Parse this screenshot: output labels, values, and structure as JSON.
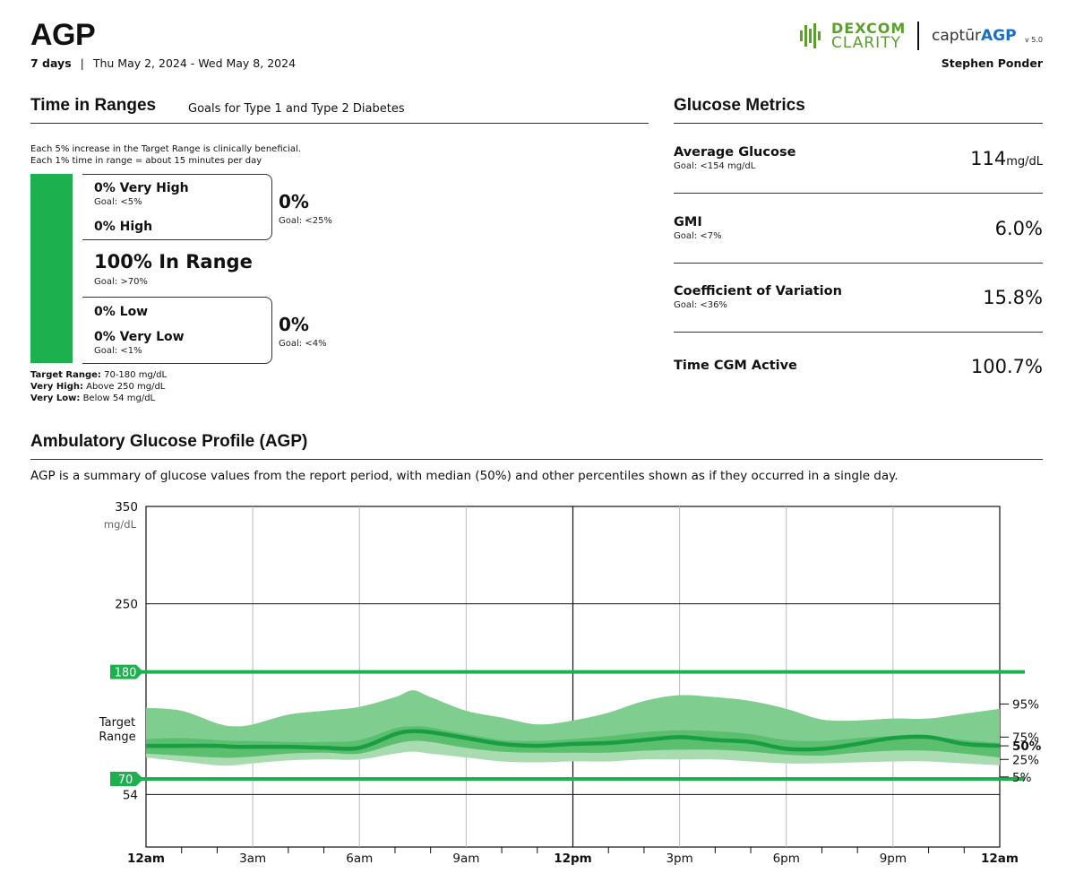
{
  "header": {
    "title": "AGP",
    "days": "7 days",
    "separator": "|",
    "date_range": "Thu May 2, 2024 - Wed May 8, 2024",
    "logo_dexcom": "DEXCOM",
    "logo_clarity": "CLARITY",
    "logo_captur": "captūr",
    "logo_agp": "AGP",
    "logo_version": "v 5.0",
    "patient_name": "Stephen Ponder"
  },
  "time_in_ranges": {
    "title": "Time in Ranges",
    "subtitle": "Goals for Type 1 and Type 2 Diabetes",
    "note1": "Each 5% increase in the Target Range is clinically beneficial.",
    "note2": "Each 1% time in range = about 15 minutes per day",
    "very_high": "0% Very High",
    "very_high_goal": "Goal: <5%",
    "high": "0% High",
    "high_combined": "0%",
    "high_combined_goal": "Goal: <25%",
    "in_range": "100% In Range",
    "in_range_goal": "Goal: >70%",
    "low": "0% Low",
    "very_low": "0% Very Low",
    "very_low_goal": "Goal: <1%",
    "low_combined": "0%",
    "low_combined_goal": "Goal: <4%",
    "def_target_label": "Target Range:",
    "def_target": " 70-180 mg/dL",
    "def_vhigh_label": "Very High:",
    "def_vhigh": " Above 250 mg/dL",
    "def_vlow_label": "Very Low:",
    "def_vlow": " Below 54 mg/dL",
    "bar_color": "#1db04e",
    "in_range_fraction": 1.0
  },
  "glucose_metrics": {
    "title": "Glucose Metrics",
    "items": [
      {
        "label": "Average Glucose",
        "goal": "Goal: <154 mg/dL",
        "value": "114",
        "unit": "mg/dL"
      },
      {
        "label": "GMI",
        "goal": "Goal: <7%",
        "value": "6.0%",
        "unit": ""
      },
      {
        "label": "Coefficient of Variation",
        "goal": "Goal: <36%",
        "value": "15.8%",
        "unit": ""
      },
      {
        "label": "Time CGM Active",
        "goal": "",
        "value": "100.7%",
        "unit": ""
      }
    ]
  },
  "agp": {
    "title": "Ambulatory Glucose Profile (AGP)",
    "description": "AGP is a summary of glucose values from the report period, with median (50%) and other percentiles shown as if they occurred in a single day."
  },
  "chart_data": {
    "type": "area",
    "ylabel": "mg/dL",
    "y_ticks": [
      "350",
      "250",
      "54"
    ],
    "target_low_label": "70",
    "target_high_label": "180",
    "target_range_label": [
      "Target",
      "Range"
    ],
    "target_range": [
      70,
      180
    ],
    "ylim": [
      0,
      350
    ],
    "x_tick_labels": [
      "12am",
      "3am",
      "6am",
      "9am",
      "12pm",
      "3pm",
      "6pm",
      "9pm",
      "12am"
    ],
    "x_hours": [
      0,
      3,
      6,
      9,
      12,
      15,
      18,
      21,
      24
    ],
    "percentile_labels": [
      "95%",
      "75%",
      "50%",
      "25%",
      "5%"
    ],
    "colors": {
      "band_95": "#7fce8f",
      "band_75": "#5cbf70",
      "band_25": "#a8dcb0",
      "median": "#1a9e43",
      "target_line": "#1db04e"
    },
    "x": [
      0,
      1,
      2,
      2.5,
      3,
      4,
      5,
      6,
      7,
      7.5,
      8,
      9,
      10,
      11,
      12,
      13,
      14,
      15,
      16,
      17,
      18,
      19,
      20,
      21,
      22,
      23,
      24
    ],
    "series": [
      {
        "name": "95%",
        "values": [
          143,
          140,
          127,
          124,
          126,
          136,
          140,
          144,
          154,
          161,
          154,
          140,
          133,
          126,
          130,
          138,
          150,
          156,
          154,
          150,
          142,
          131,
          130,
          132,
          132,
          137,
          142
        ]
      },
      {
        "name": "75%",
        "values": [
          111,
          112,
          110,
          109,
          109,
          108,
          108,
          110,
          122,
          124,
          123,
          116,
          110,
          109,
          111,
          114,
          118,
          120,
          119,
          116,
          110,
          109,
          112,
          114,
          114,
          110,
          107
        ]
      },
      {
        "name": "50%",
        "values": [
          104,
          104,
          104,
          103,
          103,
          103,
          102,
          102,
          116,
          119,
          118,
          112,
          106,
          104,
          106,
          107,
          110,
          113,
          110,
          108,
          101,
          101,
          106,
          112,
          113,
          106,
          104
        ]
      },
      {
        "name": "25%",
        "values": [
          96,
          94,
          92,
          92,
          93,
          96,
          97,
          96,
          106,
          109,
          108,
          102,
          98,
          97,
          97,
          97,
          99,
          100,
          100,
          98,
          95,
          94,
          97,
          99,
          99,
          96,
          92
        ]
      },
      {
        "name": "5%",
        "values": [
          92,
          88,
          84,
          84,
          86,
          89,
          90,
          90,
          96,
          98,
          96,
          92,
          88,
          87,
          88,
          88,
          90,
          90,
          90,
          88,
          86,
          86,
          87,
          88,
          88,
          86,
          84
        ]
      }
    ]
  }
}
